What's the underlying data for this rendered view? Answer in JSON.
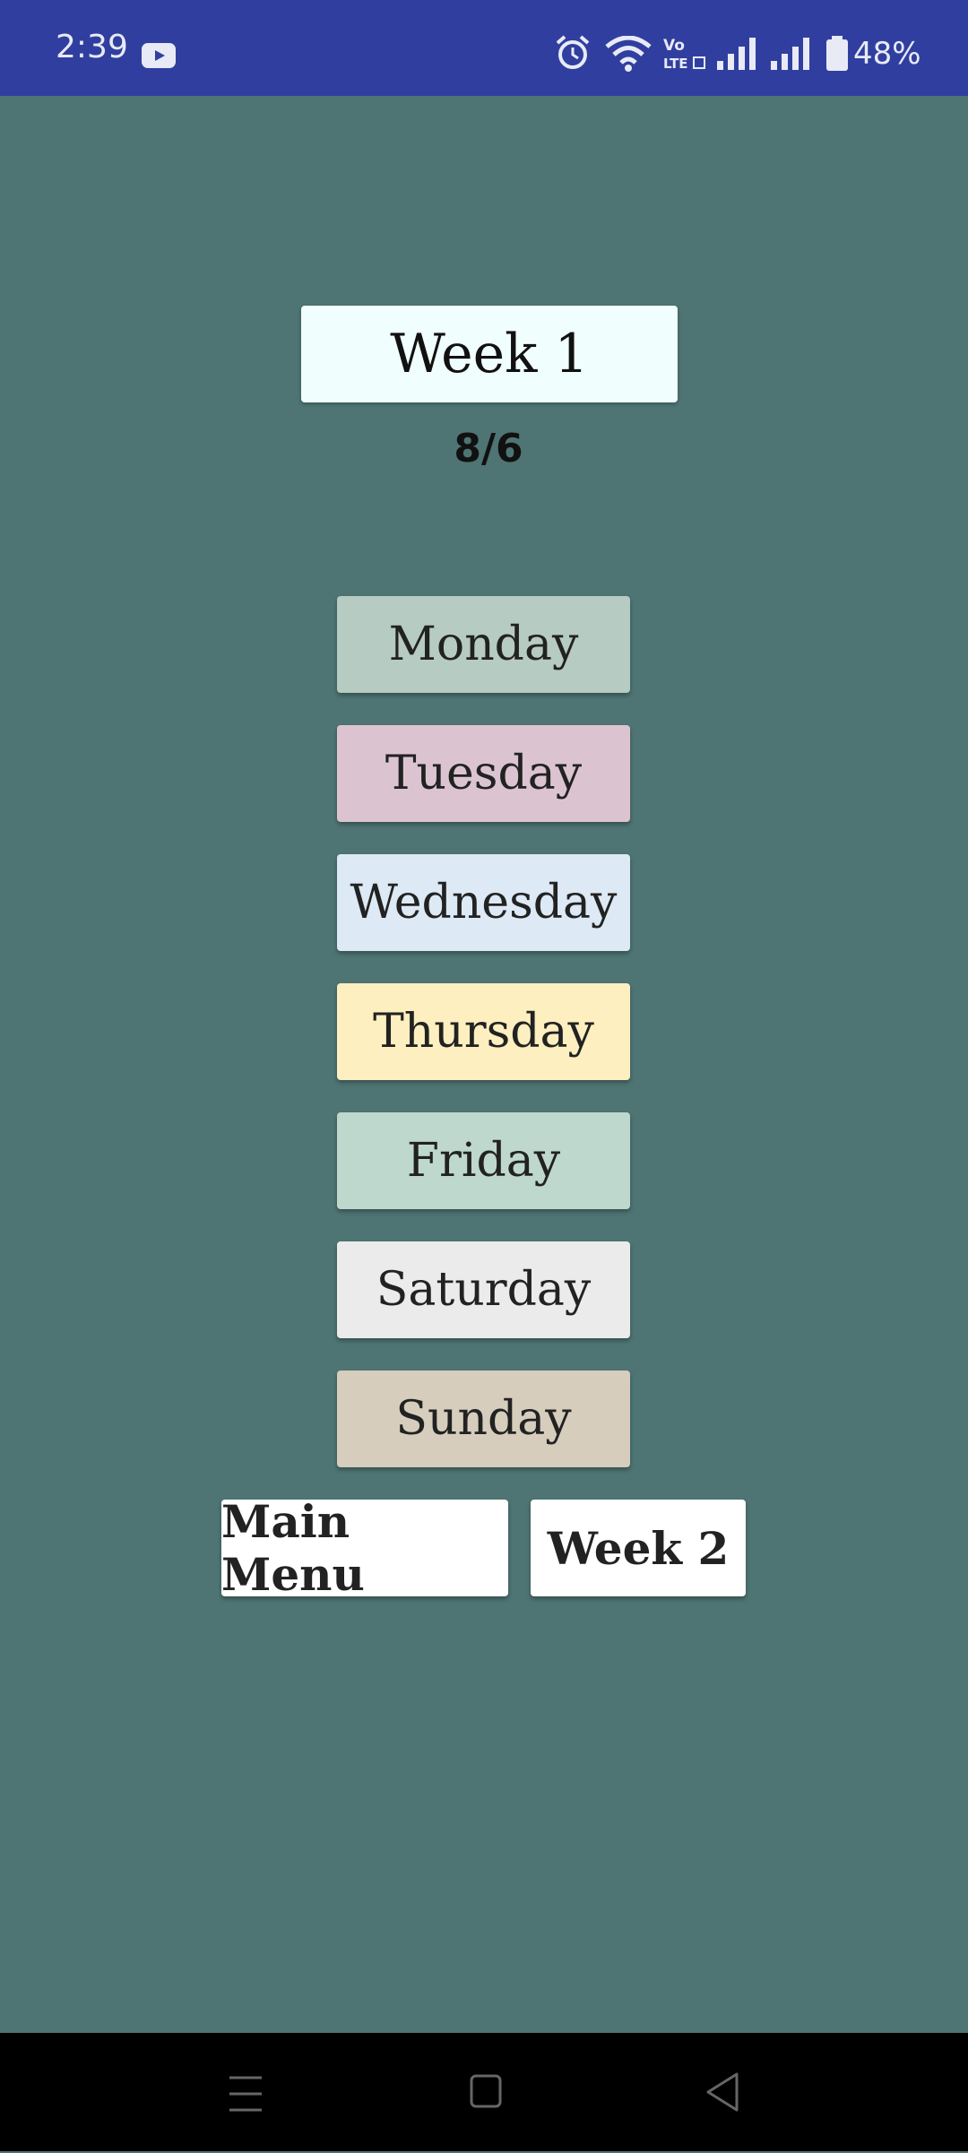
{
  "status_bar": {
    "time": "2:39",
    "battery_pct": "48%",
    "icons": [
      "youtube-icon",
      "alarm-icon",
      "wifi-icon",
      "volte-icon",
      "signal-icon",
      "signal-icon",
      "battery-icon"
    ]
  },
  "title": "Week 1",
  "date": "8/6",
  "days": [
    {
      "label": "Monday",
      "color": "#b6cbc1"
    },
    {
      "label": "Tuesday",
      "color": "#dbc4d0"
    },
    {
      "label": "Wednesday",
      "color": "#dde9f5"
    },
    {
      "label": "Thursday",
      "color": "#fdefbf"
    },
    {
      "label": "Friday",
      "color": "#bed8cd"
    },
    {
      "label": "Saturday",
      "color": "#ebebeb"
    },
    {
      "label": "Sunday",
      "color": "#d6cdbd"
    }
  ],
  "buttons": {
    "main_menu": "Main Menu",
    "week2": "Week 2"
  },
  "nav": [
    "menu-icon",
    "home-icon",
    "back-icon"
  ]
}
